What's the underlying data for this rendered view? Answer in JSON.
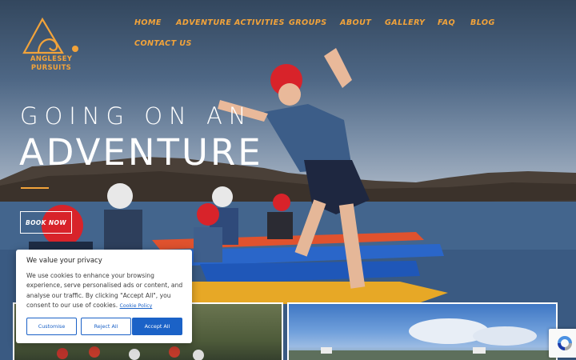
{
  "brand": {
    "name_line1": "ANGLESEY",
    "name_line2": "PURSUITS",
    "accent_color": "#f2a33a"
  },
  "nav": {
    "items": [
      {
        "label": "HOME"
      },
      {
        "label": "ADVENTURE ACTIVITIES"
      },
      {
        "label": "GROUPS"
      },
      {
        "label": "ABOUT"
      },
      {
        "label": "GALLERY"
      },
      {
        "label": "FAQ"
      },
      {
        "label": "BLOG"
      },
      {
        "label": "CONTACT US"
      }
    ]
  },
  "hero": {
    "headline_line1": "GOING ON AN",
    "headline_line2": "ADVENTURE",
    "cta_label": "BOOK NOW"
  },
  "cookie_banner": {
    "title": "We value your privacy",
    "body": "We use cookies to enhance your browsing experience, serve personalised ads or content, and analyse our traffic. By clicking \"Accept All\", you consent to our use of cookies.",
    "policy_link": "Cookie Policy",
    "customise_label": "Customise",
    "reject_label": "Reject All",
    "accept_label": "Accept All",
    "button_color": "#1b62c7"
  },
  "icons": {
    "logo": "wave-triangle-logo-icon",
    "recaptcha": "recaptcha-icon"
  }
}
